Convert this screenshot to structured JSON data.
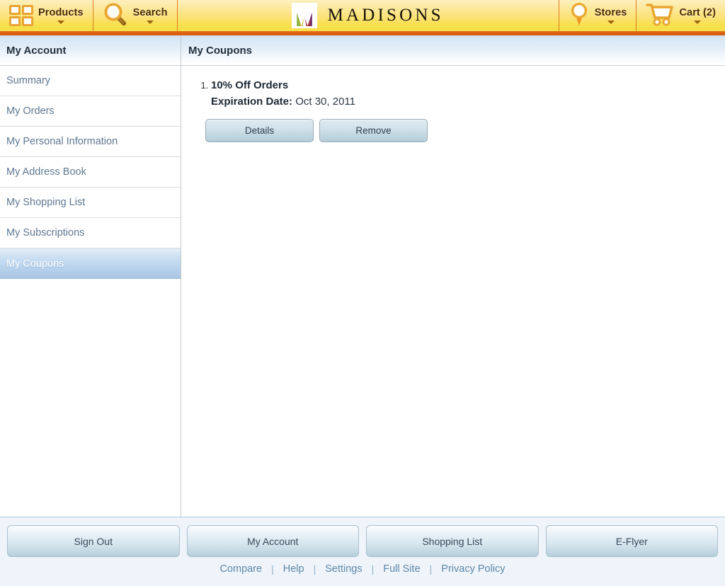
{
  "header": {
    "products": {
      "label": "Products",
      "icon": "grid-icon",
      "caret": true
    },
    "search": {
      "label": "Search",
      "icon": "magnifier-icon",
      "caret": true
    },
    "brand": {
      "name": "MADISONS",
      "logo": "madisons-m-logo"
    },
    "stores": {
      "label": "Stores",
      "icon": "map-pin-icon",
      "caret": true
    },
    "cart": {
      "label": "Cart (2)",
      "icon": "shopping-cart-icon",
      "caret": true,
      "count": 2
    },
    "colors": {
      "gradient_top": "#fdf0bd",
      "gradient_bottom": "#f5de48",
      "accent_bar": "#e36a18",
      "divider": "#e07b1f",
      "label_text": "#4a2c06"
    }
  },
  "sidebar": {
    "title": "My Account",
    "items": [
      {
        "label": "Summary",
        "selected": false
      },
      {
        "label": "My Orders",
        "selected": false
      },
      {
        "label": "My Personal Information",
        "selected": false
      },
      {
        "label": "My Address Book",
        "selected": false
      },
      {
        "label": "My Shopping List",
        "selected": false
      },
      {
        "label": "My Subscriptions",
        "selected": false
      },
      {
        "label": "My Coupons",
        "selected": true
      }
    ],
    "link_color": "#5e7893",
    "selected_text_color": "#ffffff"
  },
  "main": {
    "title": "My Coupons",
    "coupons": [
      {
        "index": "1.",
        "name": "10% Off Orders",
        "expiration_label": "Expiration Date:",
        "expiration_date": "Oct 30, 2011",
        "details_label": "Details",
        "remove_label": "Remove"
      }
    ]
  },
  "footer": {
    "buttons": [
      {
        "label": "Sign Out"
      },
      {
        "label": "My Account"
      },
      {
        "label": "Shopping List"
      },
      {
        "label": "E-Flyer"
      }
    ],
    "links": [
      {
        "label": "Compare"
      },
      {
        "label": "Help"
      },
      {
        "label": "Settings"
      },
      {
        "label": "Full Site"
      },
      {
        "label": "Privacy Policy"
      }
    ],
    "separator": "|",
    "link_color": "#5e87a8",
    "background": "#eef4fa"
  }
}
